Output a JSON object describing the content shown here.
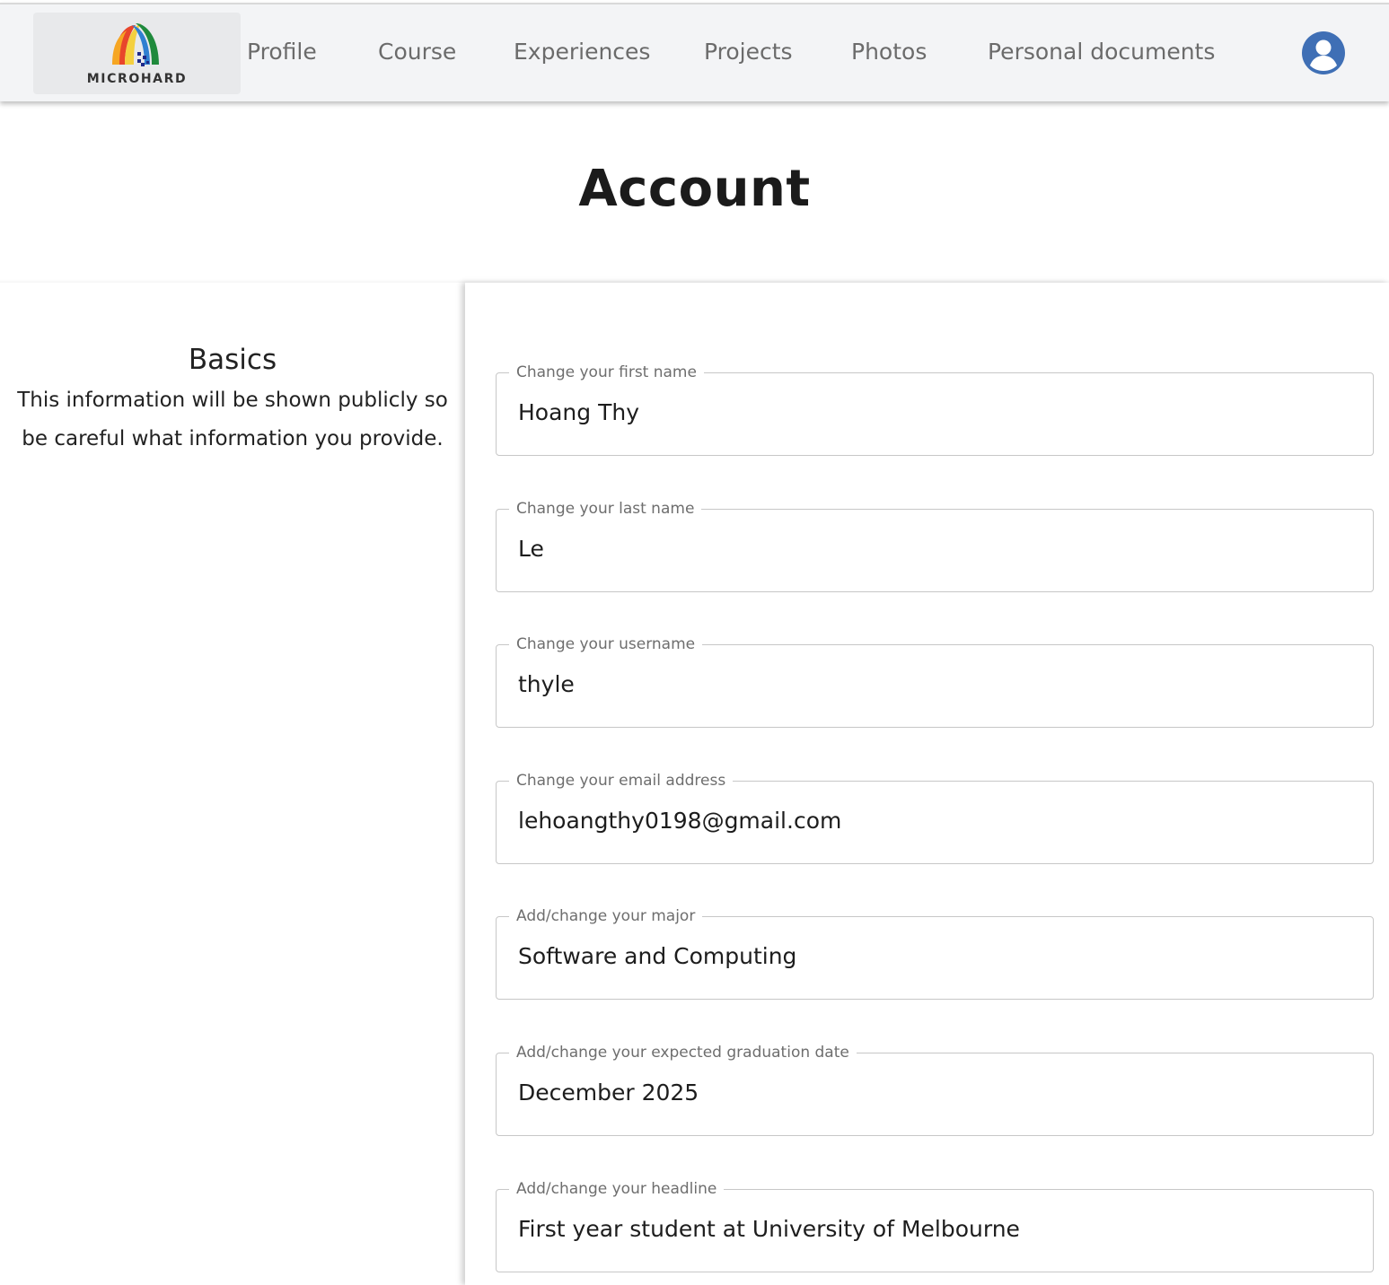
{
  "brand": {
    "name": "MICROHARD"
  },
  "nav": {
    "items": [
      {
        "label": "Profile"
      },
      {
        "label": "Course"
      },
      {
        "label": "Experiences"
      },
      {
        "label": "Projects"
      },
      {
        "label": "Photos"
      },
      {
        "label": "Personal documents"
      }
    ],
    "account_icon": "user-circle-icon"
  },
  "page": {
    "title": "Account"
  },
  "basics": {
    "title": "Basics",
    "description": "This information will be shown publicly so be careful what information you provide."
  },
  "form": {
    "fields": [
      {
        "label": "Change your first name",
        "value": "Hoang Thy"
      },
      {
        "label": "Change your last name",
        "value": "Le"
      },
      {
        "label": "Change your username",
        "value": "thyle"
      },
      {
        "label": "Change your email address",
        "value": "lehoangthy0198@gmail.com"
      },
      {
        "label": "Add/change your major",
        "value": "Software and Computing"
      },
      {
        "label": "Add/change your expected graduation date",
        "value": "December 2025"
      },
      {
        "label": "Add/change your headline",
        "value": "First year student at University of Melbourne"
      }
    ]
  },
  "colors": {
    "navbar_bg": "#f3f4f6",
    "accent_blue": "#3f6fb5",
    "nav_text": "#6b6b6b",
    "field_border": "#c7c7c7"
  }
}
